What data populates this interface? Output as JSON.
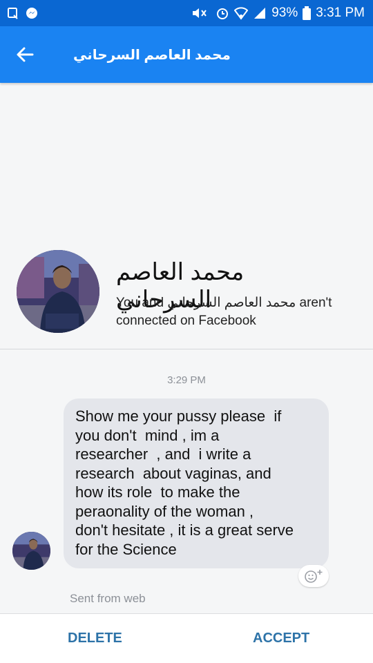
{
  "status_bar": {
    "battery_percent": "93%",
    "time": "3:31 PM",
    "icons": [
      "screenshot-icon",
      "messenger-icon",
      "mute-icon",
      "alarm-icon",
      "wifi-icon",
      "signal-icon",
      "battery-icon"
    ]
  },
  "header": {
    "title": "محمد العاصم السرحاني",
    "back_icon": "arrow-left-icon"
  },
  "profile": {
    "name": "محمد العاصم السرحاني",
    "connection_prefix": "You and ",
    "connection_name": "محمد العاصم السرحاني",
    "connection_suffix": " aren't connected on Facebook"
  },
  "conversation": {
    "timestamp": "3:29 PM",
    "message_lines": [
      "Show me your pussy please  if",
      "you don't  mind , im a",
      "researcher  , and  i write a",
      "research  about vaginas, and",
      "how its role  to make the",
      "peraonality of the woman ,",
      "don't hesitate , it is a great serve",
      "for the Science"
    ],
    "reaction_icon": "add-reaction-icon",
    "sent_from": "Sent from web"
  },
  "actions": {
    "delete_label": "DELETE",
    "accept_label": "ACCEPT"
  },
  "colors": {
    "status_bar": "#0a67d2",
    "app_bar": "#1a83f2",
    "bubble": "#e4e6eb",
    "action_text": "#2d73a8"
  }
}
